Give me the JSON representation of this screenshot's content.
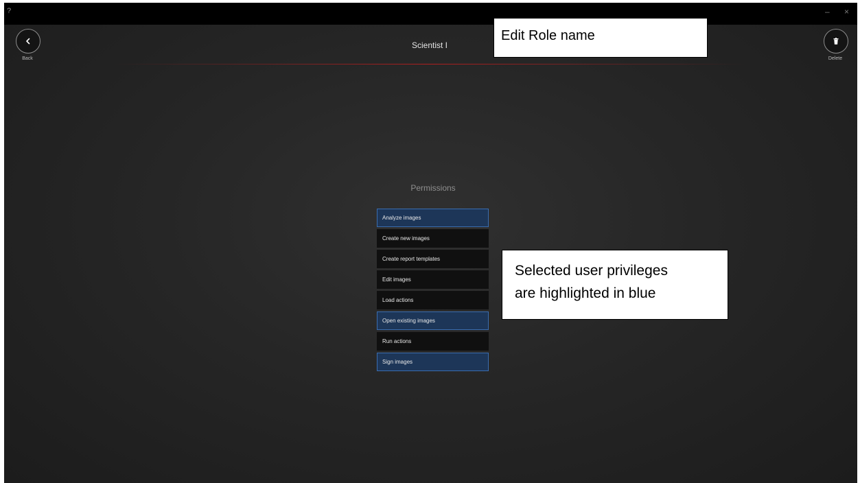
{
  "titlebar": {
    "help": "?",
    "minimize": "–",
    "close": "×"
  },
  "header": {
    "back_label": "Back",
    "delete_label": "Delete",
    "role_name": "Scientist I",
    "accent_color": "#c81e1e"
  },
  "permissions": {
    "heading": "Permissions",
    "selected_color": "#1d3658",
    "items": [
      {
        "label": "Analyze images",
        "selected": true
      },
      {
        "label": "Create new images",
        "selected": false
      },
      {
        "label": "Create report templates",
        "selected": false
      },
      {
        "label": "Edit images",
        "selected": false
      },
      {
        "label": "Load actions",
        "selected": false
      },
      {
        "label": "Open existing images",
        "selected": true
      },
      {
        "label": "Run actions",
        "selected": false
      },
      {
        "label": "Sign images",
        "selected": true
      }
    ]
  },
  "annotations": {
    "role_callout": "Edit Role name",
    "privileges_callout_line1": "Selected user privileges",
    "privileges_callout_line2": "are highlighted in blue"
  },
  "icons": {
    "back": "chevron-left-icon",
    "delete": "trash-icon"
  }
}
